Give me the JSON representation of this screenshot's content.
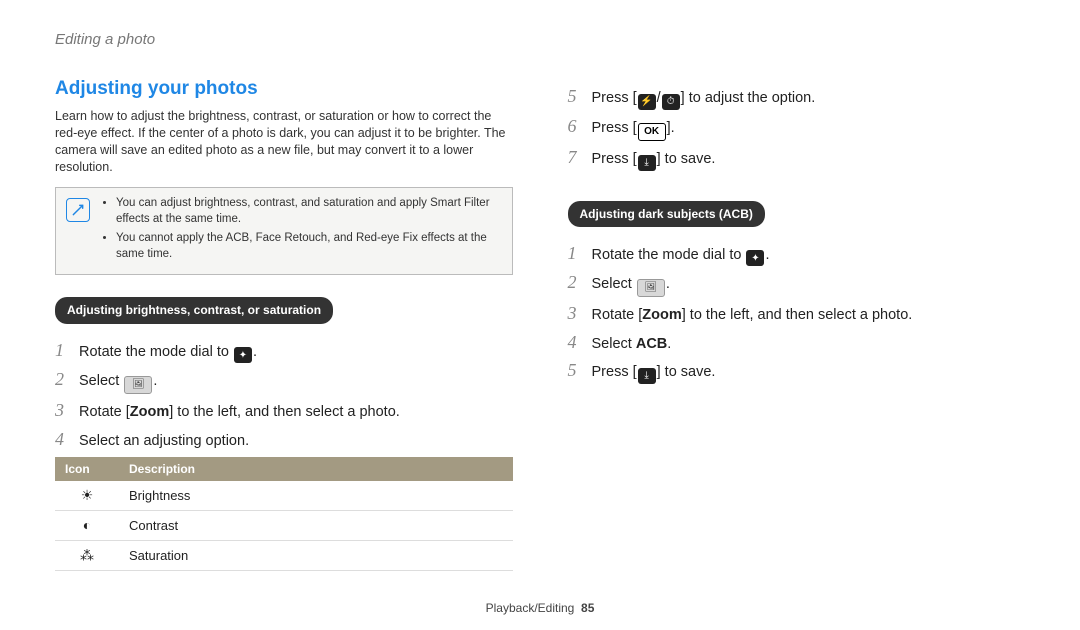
{
  "section_label": "Editing a photo",
  "title": "Adjusting your photos",
  "intro": "Learn how to adjust the brightness, contrast, or saturation or how to correct the red-eye effect. If the center of a photo is dark, you can adjust it to be brighter. The camera will save an edited photo as a new file, but may convert it to a lower resolution.",
  "notes": [
    "You can adjust brightness, contrast, and saturation and apply Smart Filter effects at the same time.",
    "You cannot apply the ACB, Face Retouch, and Red-eye Fix effects at the same time."
  ],
  "pill_left": "Adjusting brightness, contrast, or saturation",
  "pill_right": "Adjusting dark subjects (ACB)",
  "steps_left": {
    "s1_a": "Rotate the mode dial to ",
    "s1_b": ".",
    "s2_a": "Select ",
    "s2_b": ".",
    "s3_a": "Rotate [",
    "s3_zoom": "Zoom",
    "s3_b": "] to the left, and then select a photo.",
    "s4": "Select an adjusting option."
  },
  "opt_table": {
    "h_icon": "Icon",
    "h_desc": "Description",
    "rows": [
      {
        "icon": "☀",
        "desc": "Brightness"
      },
      {
        "icon": "◐",
        "desc": "Contrast"
      },
      {
        "icon": "⁂",
        "desc": "Saturation"
      }
    ]
  },
  "steps_right_a": {
    "s5_a": "Press [",
    "s5_b": "/",
    "s5_c": "] to adjust the option.",
    "s6_a": "Press [",
    "s6_ok": "OK",
    "s6_b": "].",
    "s7_a": "Press [",
    "s7_b": "] to save."
  },
  "steps_right_b": {
    "s1_a": "Rotate the mode dial to ",
    "s1_b": ".",
    "s2_a": "Select ",
    "s2_b": ".",
    "s3_a": "Rotate [",
    "s3_zoom": "Zoom",
    "s3_b": "] to the left, and then select a photo.",
    "s4_a": "Select ",
    "s4_acb": "ACB",
    "s4_b": ".",
    "s5_a": "Press [",
    "s5_b": "] to save."
  },
  "icons": {
    "mode_dial": "✦",
    "edit_tool": "🖼",
    "flash": "⚡",
    "timer": "⏱",
    "download": "⤓",
    "ok": "OK",
    "note": "✎"
  },
  "footer": {
    "label": "Playback/Editing",
    "page": "85"
  }
}
